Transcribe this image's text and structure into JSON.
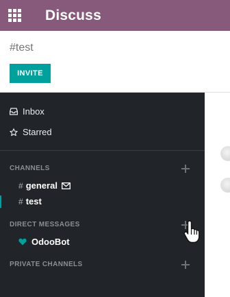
{
  "topbar": {
    "app_title": "Discuss",
    "menu_icon": "apps-grid-icon",
    "color": "#875a7b"
  },
  "control_panel": {
    "channel_heading": "#test",
    "invite_label": "INVITE",
    "accent": "#00a09d"
  },
  "sidebar": {
    "mailboxes": [
      {
        "label": "Inbox",
        "icon": "inbox-icon"
      },
      {
        "label": "Starred",
        "icon": "star-icon"
      }
    ],
    "channels": {
      "title": "CHANNELS",
      "items": [
        {
          "prefix": "#",
          "label": "general",
          "icon": "envelope-icon"
        },
        {
          "prefix": "#",
          "label": "test",
          "active": true
        }
      ]
    },
    "direct_messages": {
      "title": "DIRECT MESSAGES",
      "items": [
        {
          "label": "OdooBot",
          "icon": "heart-icon",
          "icon_color": "#00a09d"
        }
      ]
    },
    "private_channels": {
      "title": "PRIVATE CHANNELS"
    }
  }
}
